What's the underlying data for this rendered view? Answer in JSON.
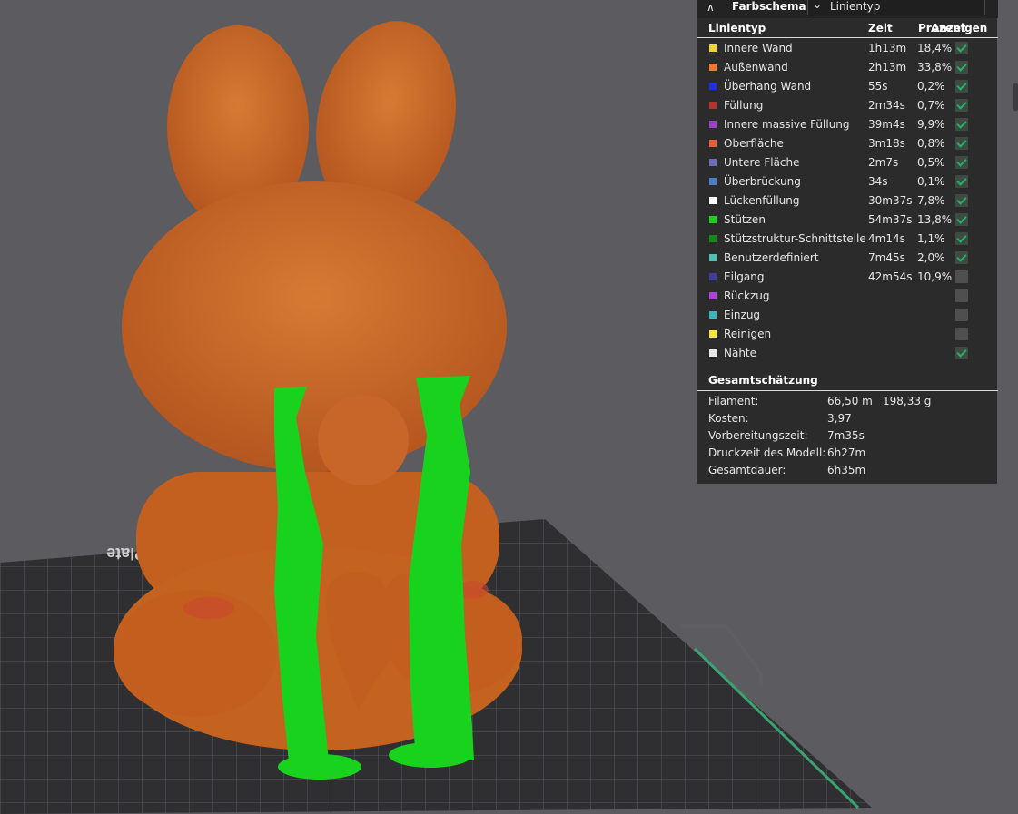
{
  "panel": {
    "title": "Farbschema",
    "scheme_selected": "Linientyp",
    "columns": {
      "name": "Linientyp",
      "time": "Zeit",
      "percent": "Prozent",
      "show": "Anzeigen"
    },
    "rows": [
      {
        "name": "Innere Wand",
        "time": "1h13m",
        "percent": "18,4%",
        "color": "#f2d23a",
        "visible": true
      },
      {
        "name": "Außenwand",
        "time": "2h13m",
        "percent": "33,8%",
        "color": "#f07a2a",
        "visible": true
      },
      {
        "name": "Überhang Wand",
        "time": "55s",
        "percent": "0,2%",
        "color": "#1e2ee8",
        "visible": true
      },
      {
        "name": "Füllung",
        "time": "2m34s",
        "percent": "0,7%",
        "color": "#b8322a",
        "visible": true
      },
      {
        "name": "Innere massive Füllung",
        "time": "39m4s",
        "percent": "9,9%",
        "color": "#9b42c8",
        "visible": true
      },
      {
        "name": "Oberfläche",
        "time": "3m18s",
        "percent": "0,8%",
        "color": "#f05a3c",
        "visible": true
      },
      {
        "name": "Untere Fläche",
        "time": "2m7s",
        "percent": "0,5%",
        "color": "#6a6ab8",
        "visible": true
      },
      {
        "name": "Überbrückung",
        "time": "34s",
        "percent": "0,1%",
        "color": "#4a7ec8",
        "visible": true
      },
      {
        "name": "Lückenfüllung",
        "time": "30m37s",
        "percent": "7,8%",
        "color": "#ffffff",
        "visible": true
      },
      {
        "name": "Stützen",
        "time": "54m37s",
        "percent": "13,8%",
        "color": "#18d21e",
        "visible": true
      },
      {
        "name": "Stützstruktur-Schnittstelle",
        "time": "4m14s",
        "percent": "1,1%",
        "color": "#118a18",
        "visible": true
      },
      {
        "name": "Benutzerdefiniert",
        "time": "7m45s",
        "percent": "2,0%",
        "color": "#4cc3b4",
        "visible": true
      },
      {
        "name": "Eilgang",
        "time": "42m54s",
        "percent": "10,9%",
        "color": "#3d3d9e",
        "visible": false
      },
      {
        "name": "Rückzug",
        "time": "",
        "percent": "",
        "color": "#b040e0",
        "visible": false
      },
      {
        "name": "Einzug",
        "time": "",
        "percent": "",
        "color": "#3ab6c0",
        "visible": false
      },
      {
        "name": "Reinigen",
        "time": "",
        "percent": "",
        "color": "#f7e53a",
        "visible": false
      },
      {
        "name": "Nähte",
        "time": "",
        "percent": "",
        "color": "#e8e8e8",
        "visible": true
      }
    ]
  },
  "summary": {
    "title": "Gesamtschätzung",
    "filament_label": "Filament:",
    "filament_length": "66,50 m",
    "filament_weight": "198,33 g",
    "cost_label": "Kosten:",
    "cost": "3,97",
    "prep_label": "Vorbereitungszeit:",
    "prep_time": "7m35s",
    "model_label": "Druckzeit des Modell:",
    "model_time": "6h27m",
    "total_label": "Gesamtdauer:",
    "total_time": "6h35m"
  },
  "plate_label": "Bambu Textured PEI Plate",
  "colors": {
    "background": "#5b5b60",
    "model_orange": "#c8662a",
    "support_green": "#18d21e",
    "plate": "#2f2f31",
    "accent_green": "#27b06a"
  }
}
